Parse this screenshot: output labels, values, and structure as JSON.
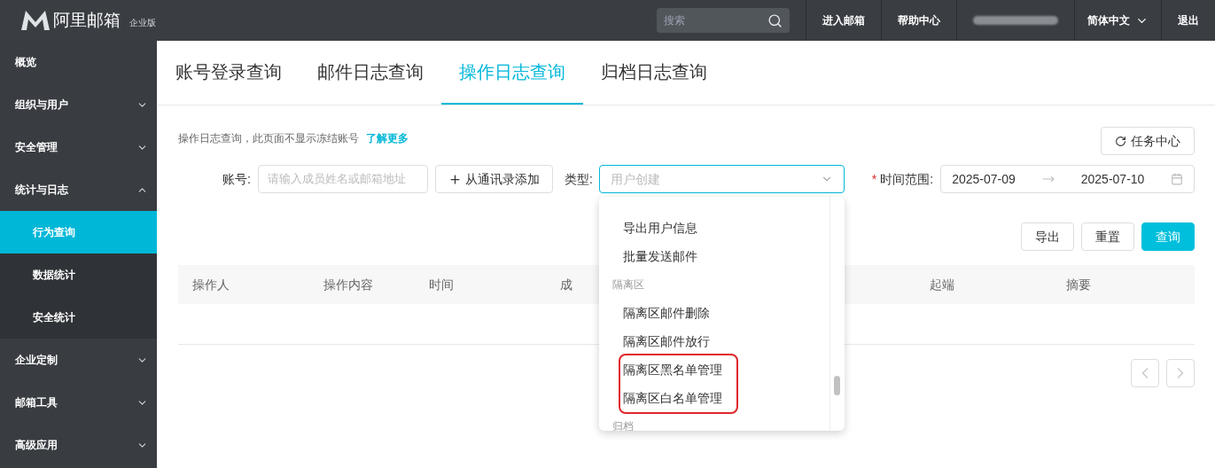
{
  "header": {
    "brand": "阿里邮箱",
    "edition": "企业版",
    "search": {
      "placeholder": "搜索"
    },
    "links": [
      {
        "label": "进入邮箱"
      },
      {
        "label": "帮助中心"
      }
    ],
    "language": "简体中文",
    "logout": "退出"
  },
  "sidebar": {
    "items": [
      {
        "label": "概览",
        "expandable": false,
        "expanded": false,
        "selected": false
      },
      {
        "label": "组织与用户",
        "expandable": true,
        "expanded": false,
        "selected": false
      },
      {
        "label": "安全管理",
        "expandable": true,
        "expanded": false,
        "selected": false
      },
      {
        "label": "统计与日志",
        "expandable": true,
        "expanded": true,
        "selected": false,
        "children": [
          {
            "label": "行为查询",
            "selected": true
          },
          {
            "label": "数据统计",
            "selected": false
          },
          {
            "label": "安全统计",
            "selected": false
          }
        ]
      },
      {
        "label": "企业定制",
        "expandable": true,
        "expanded": false,
        "selected": false
      },
      {
        "label": "邮箱工具",
        "expandable": true,
        "expanded": false,
        "selected": false
      },
      {
        "label": "高级应用",
        "expandable": true,
        "expanded": false,
        "selected": false
      }
    ]
  },
  "tabs": [
    {
      "label": "账号登录查询",
      "selected": false
    },
    {
      "label": "邮件日志查询",
      "selected": false
    },
    {
      "label": "操作日志查询",
      "selected": true
    },
    {
      "label": "归档日志查询",
      "selected": false
    }
  ],
  "notice": {
    "text": "操作日志查询，此页面不显示冻结账号",
    "link": "了解更多"
  },
  "task_center": "任务中心",
  "filters": {
    "account": {
      "label": "账号:",
      "placeholder": "请输入成员姓名或邮箱地址"
    },
    "add_from_contacts": "从通讯录添加",
    "type": {
      "label": "类型:",
      "placeholder": "用户创建",
      "open": true,
      "options": [
        {
          "kind": "item",
          "label": "导出用户信息",
          "highlighted": false
        },
        {
          "kind": "item",
          "label": "批量发送邮件",
          "highlighted": false
        },
        {
          "kind": "group",
          "label": "隔离区",
          "highlighted": false
        },
        {
          "kind": "item",
          "label": "隔离区邮件删除",
          "highlighted": false
        },
        {
          "kind": "item",
          "label": "隔离区邮件放行",
          "highlighted": false
        },
        {
          "kind": "item",
          "label": "隔离区黑名单管理",
          "highlighted": true
        },
        {
          "kind": "item",
          "label": "隔离区白名单管理",
          "highlighted": true
        },
        {
          "kind": "group",
          "label": "归档",
          "highlighted": false
        }
      ]
    },
    "time_range": {
      "label": "时间范围:",
      "required_mark": "*",
      "start": "2025-07-09",
      "end": "2025-07-10"
    }
  },
  "actions": [
    {
      "label": "导出",
      "primary": false
    },
    {
      "label": "重置",
      "primary": false
    },
    {
      "label": "查询",
      "primary": true
    }
  ],
  "table": {
    "columns": [
      "操作人",
      "操作内容",
      "时间",
      "成",
      "起端",
      "摘要"
    ]
  }
}
